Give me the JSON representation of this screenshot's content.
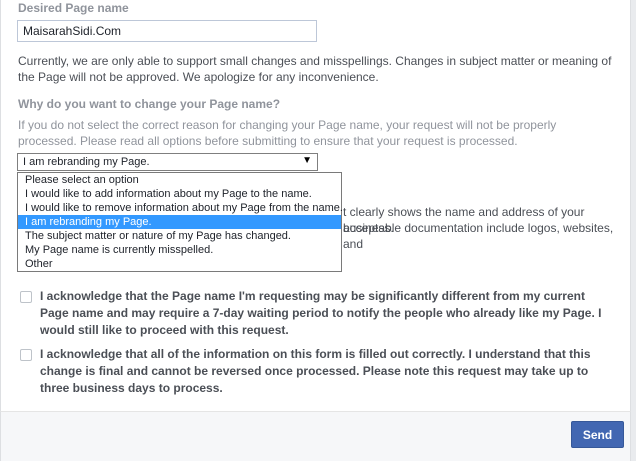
{
  "form": {
    "desired_name_label": "Desired Page name",
    "desired_name_value": "MaisarahSidi.Com",
    "support_note": "Currently, we are only able to support small changes and misspellings. Changes in subject matter or meaning of the Page will not be approved. We apologize for any inconvenience.",
    "why_label": "Why do you want to change your Page name?",
    "why_note": "If you do not select the correct reason for changing your Page name, your request will not be properly processed. Please read all options before submitting to ensure that your request is processed.",
    "reason_selected": "I am rebranding my Page.",
    "reason_options": [
      "Please select an option",
      "I would like to add information about my Page to the name.",
      "I would like to remove information about my Page from the name.",
      "I am rebranding my Page.",
      "The subject matter or nature of my Page has changed.",
      "My Page name is currently misspelled.",
      "Other"
    ],
    "selected_index": 3,
    "hidden_text_line1": "t clearly shows the name and address of your business.",
    "hidden_text_line2": "acceptable documentation include logos, websites, and",
    "ack1": "I acknowledge that the Page name I'm requesting may be significantly different from my current Page name and may require a 7-day waiting period to notify the people who already like my Page. I would still like to proceed with this request.",
    "ack2": "I acknowledge that all of the information on this form is filled out correctly. I understand that this change is final and cannot be reversed once processed. Please note this request may take up to three business days to process.",
    "send_label": "Send"
  },
  "colors": {
    "primary_button": "#4267b2",
    "dropdown_highlight": "#3399ff"
  }
}
